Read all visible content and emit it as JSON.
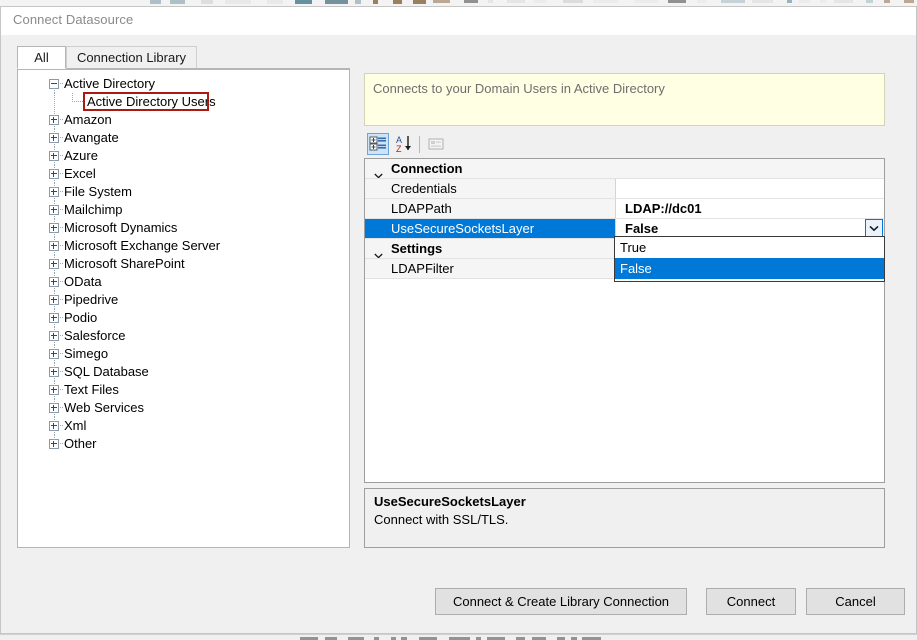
{
  "window": {
    "title": "Connect Datasource"
  },
  "tabs": [
    {
      "label": "All",
      "active": true
    },
    {
      "label": "Connection Library",
      "active": false
    }
  ],
  "tree": {
    "nodes": [
      {
        "label": "Active Directory",
        "state": "expanded",
        "level": 0
      },
      {
        "label": "Active Directory Users",
        "state": "leaf",
        "level": 1,
        "highlighted": true
      },
      {
        "label": "Amazon",
        "state": "collapsed",
        "level": 0
      },
      {
        "label": "Avangate",
        "state": "collapsed",
        "level": 0
      },
      {
        "label": "Azure",
        "state": "collapsed",
        "level": 0
      },
      {
        "label": "Excel",
        "state": "collapsed",
        "level": 0
      },
      {
        "label": "File System",
        "state": "collapsed",
        "level": 0
      },
      {
        "label": "Mailchimp",
        "state": "collapsed",
        "level": 0
      },
      {
        "label": "Microsoft Dynamics",
        "state": "collapsed",
        "level": 0
      },
      {
        "label": "Microsoft Exchange Server",
        "state": "collapsed",
        "level": 0
      },
      {
        "label": "Microsoft SharePoint",
        "state": "collapsed",
        "level": 0
      },
      {
        "label": "OData",
        "state": "collapsed",
        "level": 0
      },
      {
        "label": "Pipedrive",
        "state": "collapsed",
        "level": 0
      },
      {
        "label": "Podio",
        "state": "collapsed",
        "level": 0
      },
      {
        "label": "Salesforce",
        "state": "collapsed",
        "level": 0
      },
      {
        "label": "Simego",
        "state": "collapsed",
        "level": 0
      },
      {
        "label": "SQL Database",
        "state": "collapsed",
        "level": 0
      },
      {
        "label": "Text Files",
        "state": "collapsed",
        "level": 0
      },
      {
        "label": "Web Services",
        "state": "collapsed",
        "level": 0
      },
      {
        "label": "Xml",
        "state": "collapsed",
        "level": 0
      },
      {
        "label": "Other",
        "state": "collapsed",
        "level": 0
      }
    ]
  },
  "description_banner": {
    "text": "Connects to your Domain Users in Active Directory"
  },
  "property_toolbar": {
    "buttons": [
      {
        "name": "categorized-view-icon",
        "pressed": true
      },
      {
        "name": "alphabetical-sort-icon",
        "pressed": false
      },
      {
        "name": "property-pages-icon",
        "pressed": false
      }
    ]
  },
  "property_grid": {
    "rows": [
      {
        "kind": "category",
        "name": "Connection",
        "value": "",
        "selected": false,
        "expanded": true
      },
      {
        "kind": "property",
        "name": "Credentials",
        "value": "",
        "selected": false
      },
      {
        "kind": "property",
        "name": "LDAPPath",
        "value": "LDAP://dc01",
        "selected": false
      },
      {
        "kind": "property",
        "name": "UseSecureSocketsLayer",
        "value": "False",
        "selected": true,
        "editing": true
      },
      {
        "kind": "category",
        "name": "Settings",
        "value": "",
        "selected": false,
        "expanded": true
      },
      {
        "kind": "property",
        "name": "LDAPFilter",
        "value": "",
        "selected": false
      }
    ]
  },
  "dropdown": {
    "open": true,
    "options": [
      {
        "label": "True",
        "selected": false
      },
      {
        "label": "False",
        "selected": true
      }
    ]
  },
  "property_description": {
    "title": "UseSecureSocketsLayer",
    "body": "Connect with SSL/TLS."
  },
  "footer": {
    "connect_create_label": "Connect & Create Library Connection",
    "connect_label": "Connect",
    "cancel_label": "Cancel"
  },
  "colors": {
    "selection_blue": "#0078d7",
    "banner_yellow": "#ffffe4",
    "annotation_red": "#a81a12",
    "dialog_gray": "#f0f0f0"
  }
}
